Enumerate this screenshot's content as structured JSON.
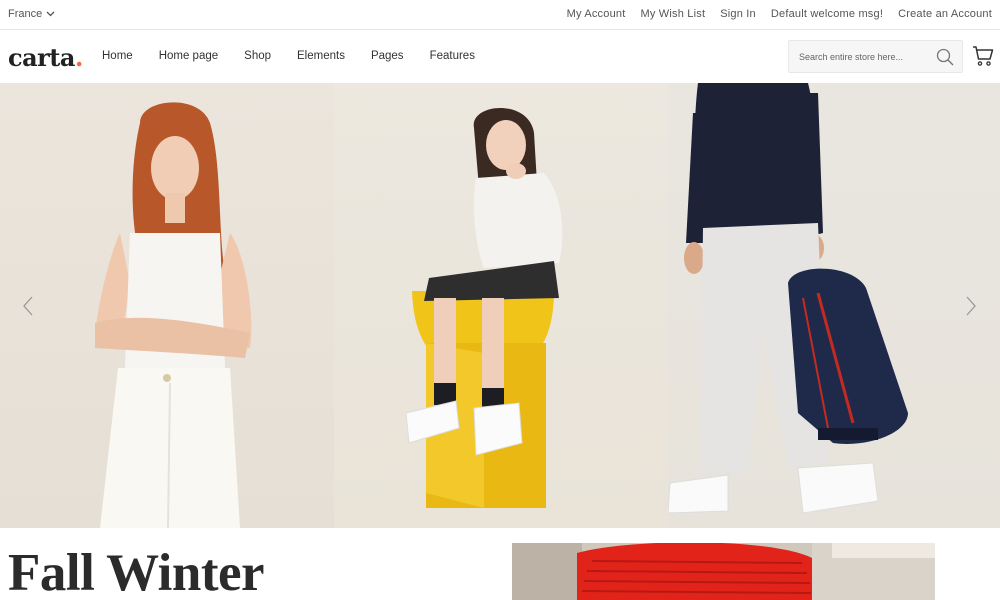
{
  "topbar": {
    "country": "France",
    "links": [
      "My Account",
      "My Wish List",
      "Sign In",
      "Default welcome msg!",
      "Create an Account"
    ]
  },
  "header": {
    "logo_text": "carta",
    "logo_dot": ".",
    "nav": [
      "Home",
      "Home page",
      "Shop",
      "Elements",
      "Pages",
      "Features"
    ],
    "search_placeholder": "Search entire store here..."
  },
  "hero": {
    "slides": [
      "woman-in-white-outfit",
      "girl-sitting-on-yellow-stool",
      "man-with-navy-backpack"
    ]
  },
  "promo": {
    "title": "Fall Winter"
  },
  "colors": {
    "accent": "#f26b38",
    "text": "#333333",
    "muted": "#555555",
    "yellow_stool": "#f0c419",
    "navy": "#1f2a4a",
    "red_knit": "#e2231a"
  }
}
